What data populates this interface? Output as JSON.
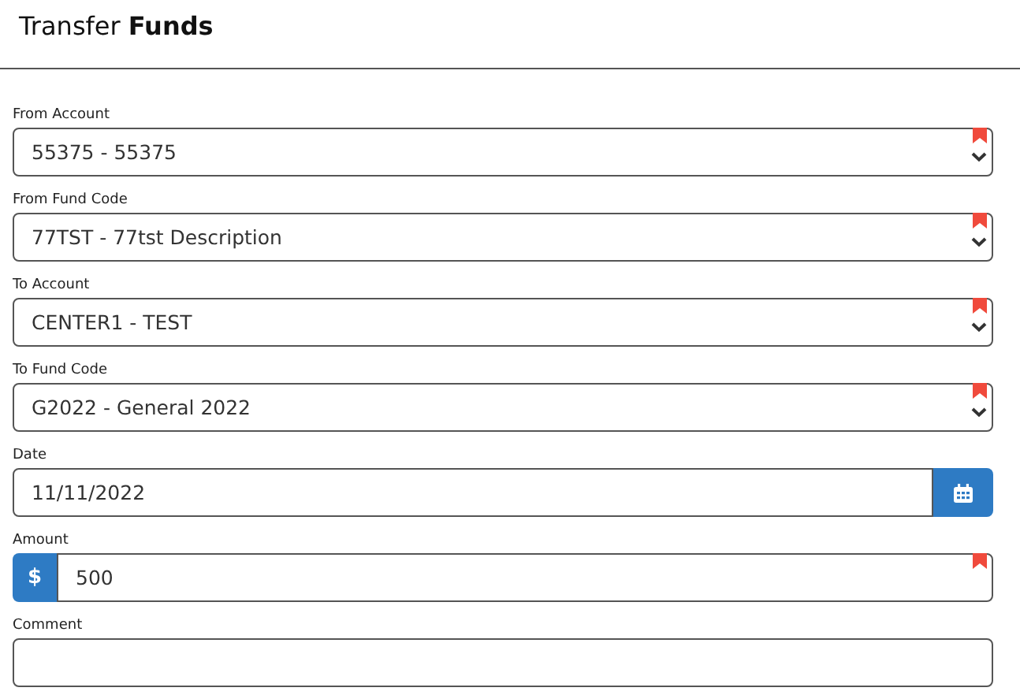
{
  "title": "Transfer **Funds**",
  "fields": [
    {
      "kind": "select",
      "label": "From Account",
      "value": "55375 - 55375",
      "required": true
    },
    {
      "kind": "select",
      "label": "From Fund Code",
      "value": "77TST - 77tst Description",
      "required": true
    },
    {
      "kind": "select",
      "label": "To Account",
      "value": "CENTER1 - TEST",
      "required": true
    },
    {
      "kind": "select",
      "label": "To Fund Code",
      "value": "G2022 - General 2022",
      "required": true
    },
    {
      "kind": "date",
      "label": "Date",
      "value": "11/11/2022",
      "required": false
    },
    {
      "kind": "amount",
      "label": "Amount",
      "value": "500",
      "prefix": "$",
      "required": true
    },
    {
      "kind": "text",
      "label": "Comment",
      "required": false
    }
  ]
}
